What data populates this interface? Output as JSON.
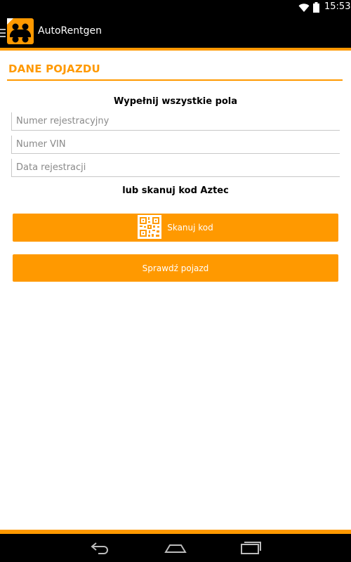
{
  "status_bar": {
    "time": "15:53",
    "icons": [
      "wifi-icon",
      "battery-icon"
    ]
  },
  "action_bar": {
    "title": "AutoRentgen",
    "icons": [
      "drawer-menu-icon",
      "app-logo-icon"
    ]
  },
  "section": {
    "title": "DANE POJAZDU"
  },
  "form": {
    "instruction": "Wypełnij wszystkie pola",
    "plate_placeholder": "Numer rejestracyjny",
    "vin_placeholder": "Numer VIN",
    "date_placeholder": "Data rejestracji",
    "or_scan_text": "lub skanuj kod Aztec",
    "scan_button_label": "Skanuj kod",
    "scan_button_icon": "aztec-code-icon",
    "check_button_label": "Sprawdź pojazd"
  },
  "nav_bar": {
    "icons": [
      "back-icon",
      "home-icon",
      "recent-apps-icon"
    ]
  },
  "colors": {
    "accent": "#ff9900",
    "bar_background": "#000000",
    "page_background": "#ffffff"
  }
}
